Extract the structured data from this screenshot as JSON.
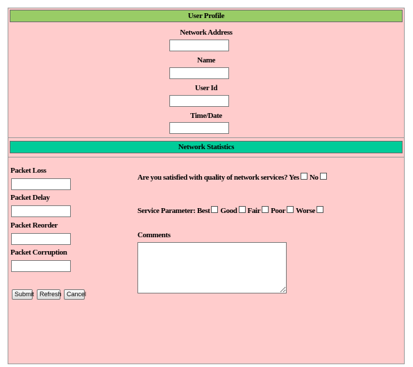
{
  "profile": {
    "title": "User Profile",
    "fields": [
      {
        "label": "Network Address",
        "value": ""
      },
      {
        "label": "Name",
        "value": ""
      },
      {
        "label": "User Id",
        "value": ""
      },
      {
        "label": "Time/Date",
        "value": ""
      }
    ]
  },
  "stats": {
    "title": "Network Statistics",
    "metrics": [
      {
        "label": "Packet Loss",
        "value": ""
      },
      {
        "label": "Packet Delay",
        "value": ""
      },
      {
        "label": "Packet Reorder",
        "value": ""
      },
      {
        "label": "Packet Corruption",
        "value": ""
      }
    ],
    "satisfaction": {
      "question": "Are you satisfied with quality of network services?",
      "yes": "Yes",
      "no": "No"
    },
    "service": {
      "label": "Service Parameter:",
      "options": [
        "Best",
        "Good",
        "Fair",
        "Poor",
        "Worse"
      ]
    },
    "comments": {
      "label": "Comments",
      "value": ""
    }
  },
  "buttons": {
    "submit": "Submit",
    "refresh": "Refresh",
    "cancel": "Cancel"
  },
  "colors": {
    "background": "#ffcccc",
    "profile_bar": "#99cc66",
    "stats_bar": "#00cc99"
  }
}
